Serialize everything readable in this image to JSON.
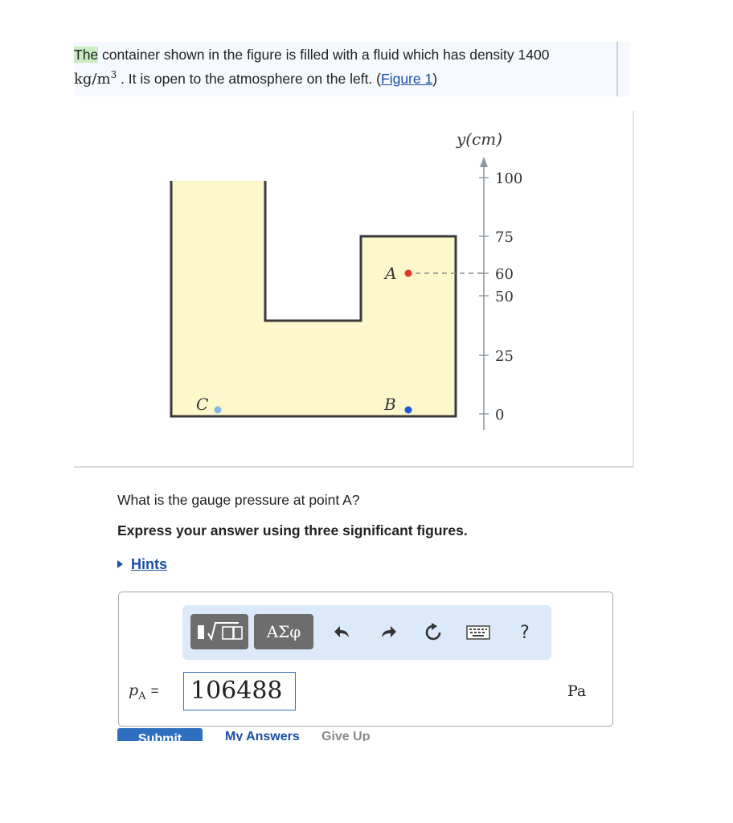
{
  "statement": {
    "word_the": "The",
    "text_1": " container shown in the figure is filled with a fluid which has density 1400",
    "unit_kg": "kg/m",
    "unit_exp": "3",
    "text_2": " . It is open to the atmosphere on the left. (",
    "figure_link": "Figure 1",
    "text_3": ")"
  },
  "figure": {
    "axis_label": "y(cm)",
    "ticks": [
      "100",
      "75",
      "60",
      "50",
      "25",
      "0"
    ],
    "point_a": "A",
    "point_b": "B",
    "point_c": "C",
    "colors": {
      "fluid": "#fdf7cc",
      "point_a": "#e23a2a",
      "point_b": "#1f57d6",
      "point_c": "#86b5e6"
    }
  },
  "question": "What is the gauge pressure at point A?",
  "instruction": "Express your answer using three significant figures.",
  "hints_label": "Hints",
  "toolbar": {
    "greek_label": "ΑΣφ",
    "help_label": "?",
    "icons": [
      "template-icon",
      "undo-icon",
      "redo-icon",
      "reset-icon",
      "keyboard-icon",
      "help-icon"
    ]
  },
  "answer": {
    "var_symbol": "p",
    "var_subscript": "A",
    "equals": "=",
    "value": "106488",
    "unit": "Pa"
  },
  "footer": {
    "submit": "Submit",
    "my_answers": "My Answers",
    "give_up": "Give Up"
  }
}
